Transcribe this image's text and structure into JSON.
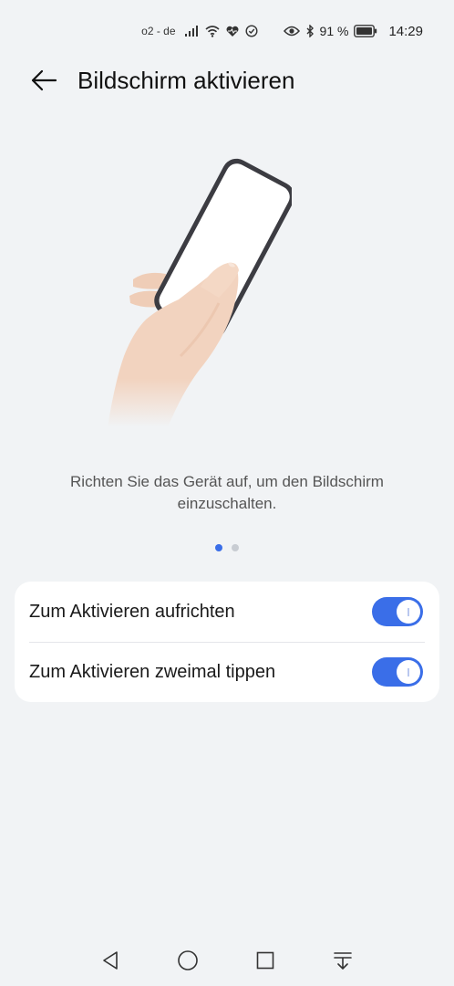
{
  "status_bar": {
    "carrier": "o2 - de",
    "battery_percent": "91 %",
    "time": "14:29",
    "icons": [
      "signal-icon",
      "wifi-icon",
      "heart-health-icon",
      "check-circle-icon",
      "eye-icon",
      "bluetooth-icon",
      "battery-icon"
    ]
  },
  "header": {
    "title": "Bildschirm aktivieren",
    "back_icon": "back-arrow-icon"
  },
  "illustration": {
    "icon": "hand-holding-phone-illustration"
  },
  "description": "Richten Sie das Gerät auf, um den Bildschirm einzuschalten.",
  "pager": {
    "count": 2,
    "active_index": 0
  },
  "settings": {
    "items": [
      {
        "label": "Zum Aktivieren aufrichten",
        "enabled": true
      },
      {
        "label": "Zum Aktivieren zweimal tippen",
        "enabled": true
      }
    ]
  },
  "navbar": {
    "icons": [
      "nav-back-icon",
      "nav-home-icon",
      "nav-recents-icon",
      "nav-notification-icon"
    ]
  },
  "colors": {
    "accent": "#3a6ee8",
    "background": "#f1f3f5",
    "card": "#ffffff"
  }
}
